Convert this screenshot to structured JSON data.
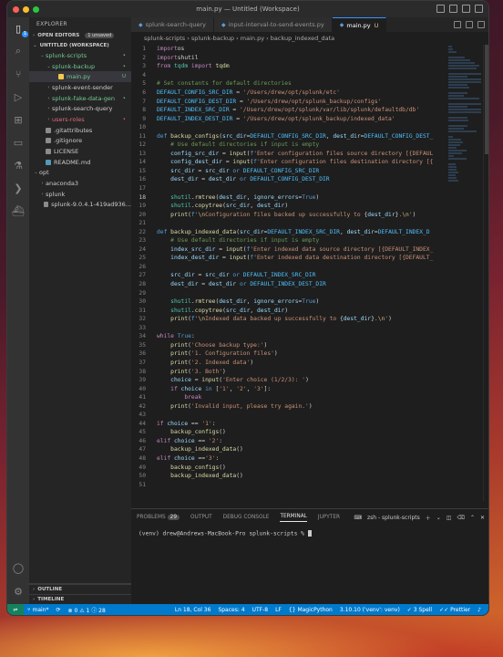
{
  "window": {
    "title": "main.py — Untitled (Workspace)"
  },
  "activity": {
    "explorer_badge": "1",
    "items": [
      "files-icon",
      "search-icon",
      "source-control-icon",
      "run-debug-icon",
      "extensions-icon",
      "remote-explorer-icon",
      "testing-icon",
      "terminal-icon",
      "docker-icon"
    ]
  },
  "sidebar": {
    "header": "EXPLORER",
    "open_editors": "OPEN EDITORS",
    "unsaved": "1 unsaved",
    "workspace": "UNTITLED (WORKSPACE)",
    "tree": [
      {
        "label": "splunk-scripts",
        "depth": 1,
        "type": "folder-open",
        "color": "green",
        "badge": "•"
      },
      {
        "label": "splunk-backup",
        "depth": 2,
        "type": "folder-open",
        "color": "green",
        "badge": "•"
      },
      {
        "label": "main.py",
        "depth": 3,
        "type": "py",
        "color": "green",
        "badge": "U",
        "selected": true
      },
      {
        "label": "splunk-event-sender",
        "depth": 2,
        "type": "folder",
        "color": "default",
        "badge": ""
      },
      {
        "label": "splunk-fake-data-gen",
        "depth": 2,
        "type": "folder",
        "color": "green",
        "badge": "•"
      },
      {
        "label": "splunk-search-query",
        "depth": 2,
        "type": "folder",
        "color": "default",
        "badge": ""
      },
      {
        "label": "users-roles",
        "depth": 2,
        "type": "folder",
        "color": "red",
        "badge": "•"
      },
      {
        "label": ".gitattributes",
        "depth": 1,
        "type": "file",
        "color": "default",
        "badge": ""
      },
      {
        "label": ".gitignore",
        "depth": 1,
        "type": "file",
        "color": "default",
        "badge": ""
      },
      {
        "label": "LICENSE",
        "depth": 1,
        "type": "file",
        "color": "default",
        "badge": ""
      },
      {
        "label": "README.md",
        "depth": 1,
        "type": "md",
        "color": "default",
        "badge": ""
      },
      {
        "label": "opt",
        "depth": 0,
        "type": "folder-open",
        "color": "default",
        "badge": ""
      },
      {
        "label": "anaconda3",
        "depth": 1,
        "type": "folder",
        "color": "default",
        "badge": ""
      },
      {
        "label": "splunk",
        "depth": 1,
        "type": "folder",
        "color": "default",
        "badge": ""
      },
      {
        "label": "splunk-9.0.4.1-419ad936...",
        "depth": 1,
        "type": "file",
        "color": "default",
        "badge": ""
      }
    ],
    "outline": "OUTLINE",
    "timeline": "TIMELINE"
  },
  "tabs": [
    {
      "label": "splunk-search-query",
      "active": false,
      "badge": ""
    },
    {
      "label": "input-interval-to-send-events.py",
      "active": false,
      "badge": ""
    },
    {
      "label": "main.py",
      "active": true,
      "badge": "U"
    }
  ],
  "breadcrumb": "splunk-scripts › splunk-backup › main.py › backup_indexed_data",
  "editor": {
    "current_line": 18,
    "lines": [
      [
        [
          "kw",
          "import"
        ],
        [
          "",
          "os"
        ]
      ],
      [
        [
          "kw",
          "import"
        ],
        [
          "",
          "shutil"
        ]
      ],
      [
        [
          "kw",
          "from"
        ],
        [
          "mod",
          " tqdm "
        ],
        [
          "kw",
          "import"
        ],
        [
          "fn",
          " tqdm"
        ]
      ],
      [],
      [
        [
          "cm",
          "# Set constants for default directories"
        ]
      ],
      [
        [
          "cst",
          "DEFAULT_CONFIG_SRC_DIR"
        ],
        [
          "",
          " = "
        ],
        [
          "str",
          "'/Users/drew/opt/splunk/etc'"
        ]
      ],
      [
        [
          "cst",
          "DEFAULT_CONFIG_DEST_DIR"
        ],
        [
          "",
          " = "
        ],
        [
          "str",
          "'/Users/drew/opt/splunk_backup/configs'"
        ]
      ],
      [
        [
          "cst",
          "DEFAULT_INDEX_SRC_DIR"
        ],
        [
          "",
          " = "
        ],
        [
          "str",
          "'/Users/drew/opt/splunk/var/lib/splunk/defaultdb/db'"
        ]
      ],
      [
        [
          "cst",
          "DEFAULT_INDEX_DEST_DIR"
        ],
        [
          "",
          " = "
        ],
        [
          "str",
          "'/Users/drew/opt/splunk_backup/indexed_data'"
        ]
      ],
      [],
      [
        [
          "kw2",
          "def"
        ],
        [
          "fn",
          " backup_configs"
        ],
        [
          "",
          "("
        ],
        [
          "var",
          "src_dir"
        ],
        [
          "",
          "="
        ],
        [
          "cst",
          "DEFAULT_CONFIG_SRC_DIR"
        ],
        [
          "",
          ", "
        ],
        [
          "var",
          "dest_dir"
        ],
        [
          "",
          "="
        ],
        [
          "cst",
          "DEFAULT_CONFIG_DEST_"
        ]
      ],
      [
        [
          "",
          "    "
        ],
        [
          "cm",
          "# Use default directories if input is empty"
        ]
      ],
      [
        [
          "var",
          "    config_src_dir"
        ],
        [
          "",
          " = "
        ],
        [
          "fn",
          "input"
        ],
        [
          "",
          "("
        ],
        [
          "kw2",
          "f"
        ],
        [
          "str",
          "'Enter configuration files source directory [{DEFAUL"
        ]
      ],
      [
        [
          "var",
          "    config_dest_dir"
        ],
        [
          "",
          " = "
        ],
        [
          "fn",
          "input"
        ],
        [
          "",
          "("
        ],
        [
          "kw2",
          "f"
        ],
        [
          "str",
          "'Enter configuration files destination directory [{"
        ]
      ],
      [
        [
          "var",
          "    src_dir"
        ],
        [
          "",
          " = "
        ],
        [
          "var",
          "src_dir"
        ],
        [
          "kw2",
          " or "
        ],
        [
          "cst",
          "DEFAULT_CONFIG_SRC_DIR"
        ]
      ],
      [
        [
          "var",
          "    dest_dir"
        ],
        [
          "",
          " = "
        ],
        [
          "var",
          "dest_dir"
        ],
        [
          "kw2",
          " or "
        ],
        [
          "cst",
          "DEFAULT_CONFIG_DEST_DIR"
        ]
      ],
      [],
      [
        [
          "mod",
          "    shutil"
        ],
        [
          "",
          "."
        ],
        [
          "fn",
          "rmtree"
        ],
        [
          "",
          "("
        ],
        [
          "var",
          "dest_dir"
        ],
        [
          "",
          ", "
        ],
        [
          "var",
          "ignore_errors"
        ],
        [
          "",
          "="
        ],
        [
          "kw2",
          "True"
        ],
        [
          "",
          ")"
        ]
      ],
      [
        [
          "mod",
          "    shutil"
        ],
        [
          "",
          "."
        ],
        [
          "fn",
          "copytree"
        ],
        [
          "",
          "("
        ],
        [
          "var",
          "src_dir"
        ],
        [
          "",
          ", "
        ],
        [
          "var",
          "dest_dir"
        ],
        [
          "",
          ")"
        ]
      ],
      [
        [
          "fn",
          "    print"
        ],
        [
          "",
          "("
        ],
        [
          "kw2",
          "f"
        ],
        [
          "str",
          "'"
        ],
        [
          "esc",
          "\\n"
        ],
        [
          "str",
          "Configuration files backed up successfully to "
        ],
        [
          "",
          "{"
        ],
        [
          "var",
          "dest_dir"
        ],
        [
          "",
          "}"
        ],
        [
          "str",
          "."
        ],
        [
          "esc",
          "\\n"
        ],
        [
          "str",
          "'"
        ],
        [
          "",
          ")"
        ]
      ],
      [],
      [
        [
          "kw2",
          "def"
        ],
        [
          "fn",
          " backup_indexed_data"
        ],
        [
          "",
          "("
        ],
        [
          "var",
          "src_dir"
        ],
        [
          "",
          "="
        ],
        [
          "cst",
          "DEFAULT_INDEX_SRC_DIR"
        ],
        [
          "",
          ", "
        ],
        [
          "var",
          "dest_dir"
        ],
        [
          "",
          "="
        ],
        [
          "cst",
          "DEFAULT_INDEX_D"
        ]
      ],
      [
        [
          "",
          "    "
        ],
        [
          "cm",
          "# Use default directories if input is empty"
        ]
      ],
      [
        [
          "var",
          "    index_src_dir"
        ],
        [
          "",
          " = "
        ],
        [
          "fn",
          "input"
        ],
        [
          "",
          "("
        ],
        [
          "kw2",
          "f"
        ],
        [
          "str",
          "'Enter indexed data source directory [{DEFAULT_INDEX_"
        ]
      ],
      [
        [
          "var",
          "    index_dest_dir"
        ],
        [
          "",
          " = "
        ],
        [
          "fn",
          "input"
        ],
        [
          "",
          "("
        ],
        [
          "kw2",
          "f"
        ],
        [
          "str",
          "'Enter indexed data destination directory [{DEFAULT_"
        ]
      ],
      [],
      [
        [
          "var",
          "    src_dir"
        ],
        [
          "",
          " = "
        ],
        [
          "var",
          "src_dir"
        ],
        [
          "kw2",
          " or "
        ],
        [
          "cst",
          "DEFAULT_INDEX_SRC_DIR"
        ]
      ],
      [
        [
          "var",
          "    dest_dir"
        ],
        [
          "",
          " = "
        ],
        [
          "var",
          "dest_dir"
        ],
        [
          "kw2",
          " or "
        ],
        [
          "cst",
          "DEFAULT_INDEX_DEST_DIR"
        ]
      ],
      [],
      [
        [
          "mod",
          "    shutil"
        ],
        [
          "",
          "."
        ],
        [
          "fn",
          "rmtree"
        ],
        [
          "",
          "("
        ],
        [
          "var",
          "dest_dir"
        ],
        [
          "",
          ", "
        ],
        [
          "var",
          "ignore_errors"
        ],
        [
          "",
          "="
        ],
        [
          "kw2",
          "True"
        ],
        [
          "",
          ")"
        ]
      ],
      [
        [
          "mod",
          "    shutil"
        ],
        [
          "",
          "."
        ],
        [
          "fn",
          "copytree"
        ],
        [
          "",
          "("
        ],
        [
          "var",
          "src_dir"
        ],
        [
          "",
          ", "
        ],
        [
          "var",
          "dest_dir"
        ],
        [
          "",
          ")"
        ]
      ],
      [
        [
          "fn",
          "    print"
        ],
        [
          "",
          "("
        ],
        [
          "kw2",
          "f"
        ],
        [
          "str",
          "'"
        ],
        [
          "esc",
          "\\n"
        ],
        [
          "str",
          "Indexed data backed up successfully to "
        ],
        [
          "",
          "{"
        ],
        [
          "var",
          "dest_dir"
        ],
        [
          "",
          "}"
        ],
        [
          "str",
          "."
        ],
        [
          "esc",
          "\\n"
        ],
        [
          "str",
          "'"
        ],
        [
          "",
          ")"
        ]
      ],
      [],
      [
        [
          "kw",
          "while"
        ],
        [
          "kw2",
          " True"
        ],
        [
          "",
          ":"
        ]
      ],
      [
        [
          "fn",
          "    print"
        ],
        [
          "",
          "("
        ],
        [
          "str",
          "'Choose backup type:'"
        ],
        [
          "",
          ")"
        ]
      ],
      [
        [
          "fn",
          "    print"
        ],
        [
          "",
          "("
        ],
        [
          "str",
          "'1. Configuration files'"
        ],
        [
          "",
          ")"
        ]
      ],
      [
        [
          "fn",
          "    print"
        ],
        [
          "",
          "("
        ],
        [
          "str",
          "'2. Indexed data'"
        ],
        [
          "",
          ")"
        ]
      ],
      [
        [
          "fn",
          "    print"
        ],
        [
          "",
          "("
        ],
        [
          "str",
          "'3. Both'"
        ],
        [
          "",
          ")"
        ]
      ],
      [
        [
          "var",
          "    choice"
        ],
        [
          "",
          " = "
        ],
        [
          "fn",
          "input"
        ],
        [
          "",
          "("
        ],
        [
          "str",
          "'Enter choice (1/2/3): '"
        ],
        [
          "",
          ")"
        ]
      ],
      [
        [
          "kw",
          "    if"
        ],
        [
          "var",
          " choice"
        ],
        [
          "kw2",
          " in "
        ],
        [
          "",
          "["
        ],
        [
          "str",
          "'1'"
        ],
        [
          "",
          ", "
        ],
        [
          "str",
          "'2'"
        ],
        [
          "",
          ", "
        ],
        [
          "str",
          "'3'"
        ],
        [
          "",
          "]:"
        ]
      ],
      [
        [
          "kw",
          "        break"
        ]
      ],
      [
        [
          "fn",
          "    print"
        ],
        [
          "",
          "("
        ],
        [
          "str",
          "'Invalid input, please try again.'"
        ],
        [
          "",
          ")"
        ]
      ],
      [],
      [
        [
          "kw",
          "if"
        ],
        [
          "var",
          " choice"
        ],
        [
          "",
          " == "
        ],
        [
          "str",
          "'1'"
        ],
        [
          "",
          ":"
        ]
      ],
      [
        [
          "fn",
          "    backup_configs"
        ],
        [
          "",
          "()"
        ]
      ],
      [
        [
          "kw",
          "elif"
        ],
        [
          "var",
          " choice"
        ],
        [
          "",
          " == "
        ],
        [
          "str",
          "'2'"
        ],
        [
          "",
          ":"
        ]
      ],
      [
        [
          "fn",
          "    backup_indexed_data"
        ],
        [
          "",
          "()"
        ]
      ],
      [
        [
          "kw",
          "elif"
        ],
        [
          "var",
          " choice"
        ],
        [
          "",
          " =="
        ],
        [
          "str",
          "'3'"
        ],
        [
          "",
          ":"
        ]
      ],
      [
        [
          "fn",
          "    backup_configs"
        ],
        [
          "",
          "()"
        ]
      ],
      [
        [
          "fn",
          "    backup_indexed_data"
        ],
        [
          "",
          "()"
        ]
      ],
      []
    ]
  },
  "panel": {
    "tabs": [
      {
        "label": "PROBLEMS",
        "count": "29",
        "active": false
      },
      {
        "label": "OUTPUT",
        "count": "",
        "active": false
      },
      {
        "label": "DEBUG CONSOLE",
        "count": "",
        "active": false
      },
      {
        "label": "TERMINAL",
        "count": "",
        "active": true
      },
      {
        "label": "JUPYTER",
        "count": "",
        "active": false
      }
    ],
    "terminal_name": "zsh - splunk-scripts",
    "prompt": "(venv) drew@Andrews-MacBook-Pro splunk-scripts % "
  },
  "statusbar": {
    "branch": "main*",
    "errors": "0",
    "warnings": "1",
    "info": "28",
    "position": "Ln 18, Col 36",
    "spaces": "Spaces: 4",
    "encoding": "UTF-8",
    "eol": "LF",
    "language": "MagicPython",
    "interpreter": "3.10.10 ('venv': venv)",
    "spell": "3 Spell",
    "prettier": "Prettier"
  }
}
